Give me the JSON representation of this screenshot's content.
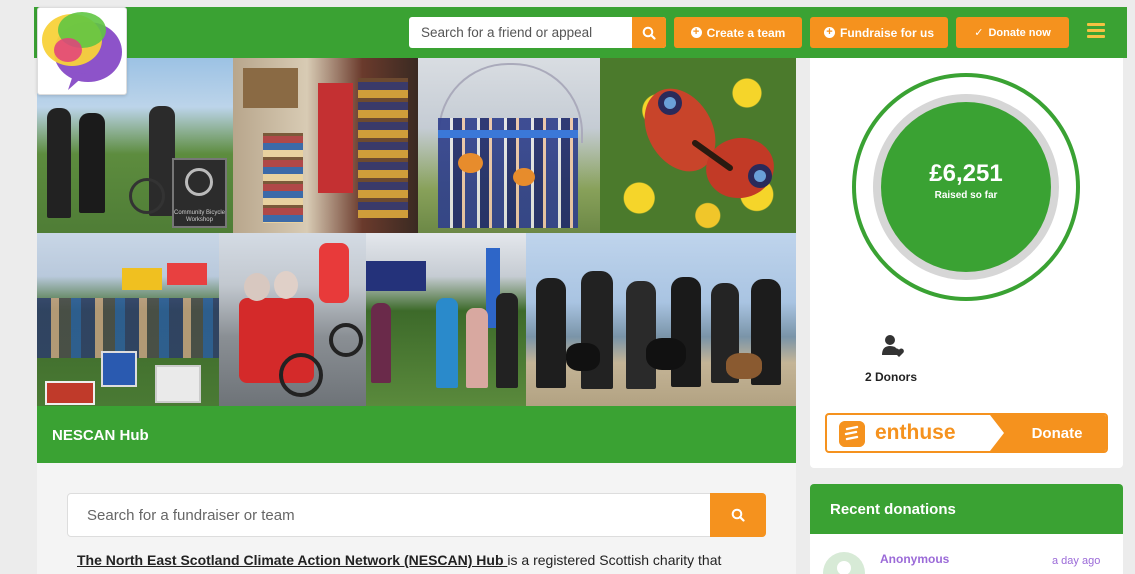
{
  "header": {
    "search_placeholder": "Search for a friend or appeal",
    "create_team_label": "Create a team",
    "fundraise_label": "Fundraise for us",
    "donate_now_label": "Donate now"
  },
  "hub": {
    "title": "NESCAN Hub",
    "search_placeholder": "Search for a fundraiser or team",
    "intro_link": "The North East Scotland Climate Action Network (NESCAN) Hub ",
    "intro_text": "is a registered Scottish charity that"
  },
  "photo_captions": {
    "bike_workshop_sign": "Community Bicycle Workshop"
  },
  "totals": {
    "amount": "£6,251",
    "raised_label": "Raised so far",
    "donors_label": "2 Donors"
  },
  "enthuse": {
    "brand": "enthuse",
    "donate_label": "Donate"
  },
  "recent_donations": {
    "heading": "Recent donations",
    "items": [
      {
        "name": "Anonymous",
        "time": "a day ago"
      }
    ]
  },
  "colors": {
    "brand_green": "#3aa233",
    "accent_orange": "#f5921e",
    "donor_purple": "#9b6ad8"
  }
}
